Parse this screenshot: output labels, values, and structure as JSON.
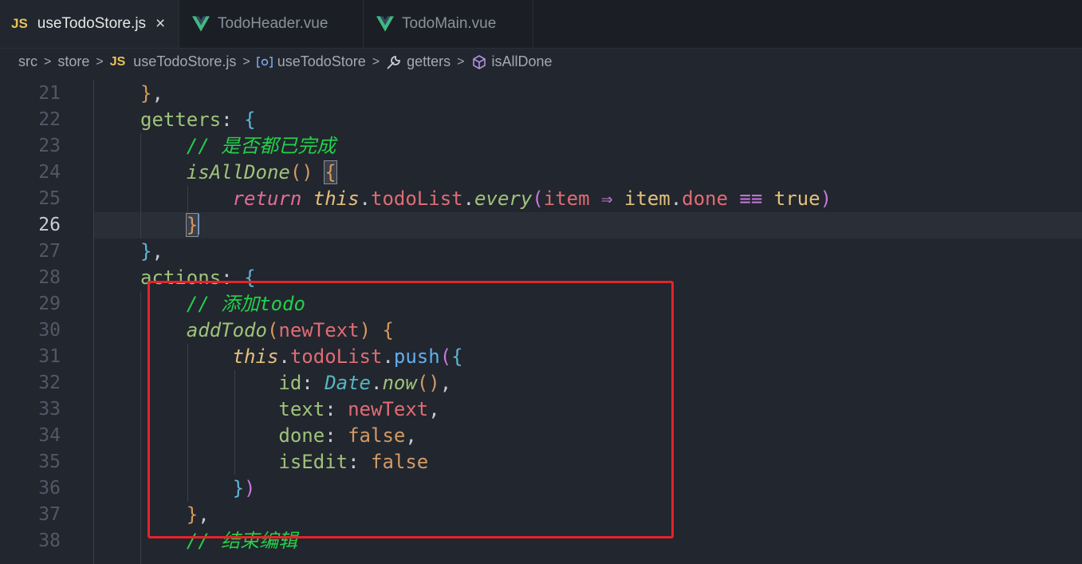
{
  "tabs": [
    {
      "label": "useTodoStore.js",
      "icon": "js-file-icon",
      "icon_text": "JS",
      "active": true,
      "closable": true
    },
    {
      "label": "TodoHeader.vue",
      "icon": "vue-file-icon",
      "active": false
    },
    {
      "label": "TodoMain.vue",
      "icon": "vue-file-icon",
      "active": false
    }
  ],
  "close_glyph": "×",
  "breadcrumb": {
    "items": [
      "src",
      "store",
      "useTodoStore.js",
      "useTodoStore",
      "getters",
      "isAllDone"
    ],
    "js_text": "JS",
    "separator": ">"
  },
  "editor": {
    "current_line": 26,
    "line_numbers": [
      "21",
      "22",
      "23",
      "24",
      "25",
      "26",
      "27",
      "28",
      "29",
      "30",
      "31",
      "32",
      "33",
      "34",
      "35",
      "36",
      "37",
      "38"
    ],
    "highlight_color": "#e4232b"
  }
}
